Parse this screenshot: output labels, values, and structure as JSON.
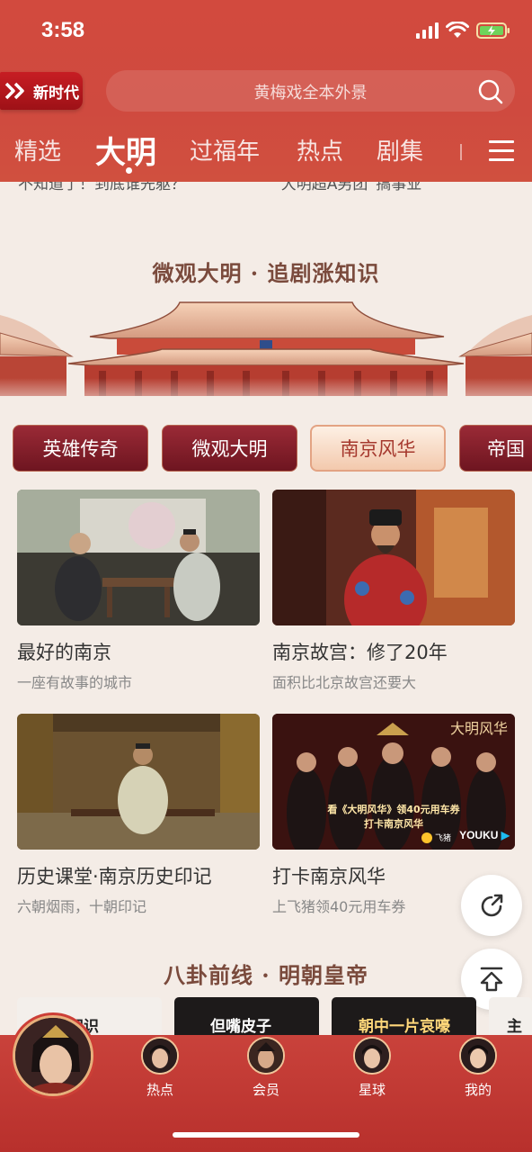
{
  "status_bar": {
    "time": "3:58"
  },
  "header": {
    "logo_text": "新时代",
    "search_placeholder": "黄梅戏全本外景",
    "tabs": [
      {
        "label": "精选",
        "active": false
      },
      {
        "label": "大明",
        "active": true
      },
      {
        "label": "过福年",
        "active": false
      },
      {
        "label": "热点",
        "active": false
      },
      {
        "label": "剧集",
        "active": false
      }
    ]
  },
  "clipped_captions": [
    "不知道了！到底谁先躯？",
    "“大明超A男团”搞事业"
  ],
  "section1": {
    "title": "微观大明 · 追剧涨知识",
    "chips": [
      {
        "label": "英雄传奇",
        "active": false
      },
      {
        "label": "微观大明",
        "active": false
      },
      {
        "label": "南京风华",
        "active": true
      },
      {
        "label": "帝国",
        "active": false
      }
    ],
    "cards": [
      {
        "title": "最好的南京",
        "subtitle": "一座有故事的城市"
      },
      {
        "title": "南京故宫：修了20年",
        "subtitle": "面积比北京故宫还要大"
      },
      {
        "title": "历史课堂·南京历史印记",
        "subtitle": "六朝烟雨，十朝印记"
      },
      {
        "title": "打卡南京风华",
        "subtitle": "上飞猪领40元用车券"
      }
    ],
    "poster": {
      "series_title": "大明风华",
      "promo_line1": "看《大明风华》领40元用车券",
      "promo_line2": "打卡南京风华",
      "brand_left": "飞猪",
      "brand_right": "YOUKU"
    }
  },
  "section2": {
    "title": "八卦前线 · 明朝皇帝",
    "thumbs": [
      "诠知识",
      "但嘴皮子",
      "朝中一片哀嚎",
      "主"
    ]
  },
  "bottom_nav": {
    "items": [
      {
        "label": "热点"
      },
      {
        "label": "会员"
      },
      {
        "label": "星球"
      },
      {
        "label": "我的"
      }
    ]
  },
  "colors": {
    "header_red": "#d24a3e",
    "nav_red": "#c9423b",
    "chip_dark": "#7e1d28",
    "chip_active_bg": "#f8dcc6",
    "page_bg": "#f4ece6"
  },
  "icons": [
    "search-icon",
    "menu-icon",
    "share-icon",
    "scroll-top-icon",
    "wifi-icon",
    "battery-icon",
    "signal-icon"
  ]
}
